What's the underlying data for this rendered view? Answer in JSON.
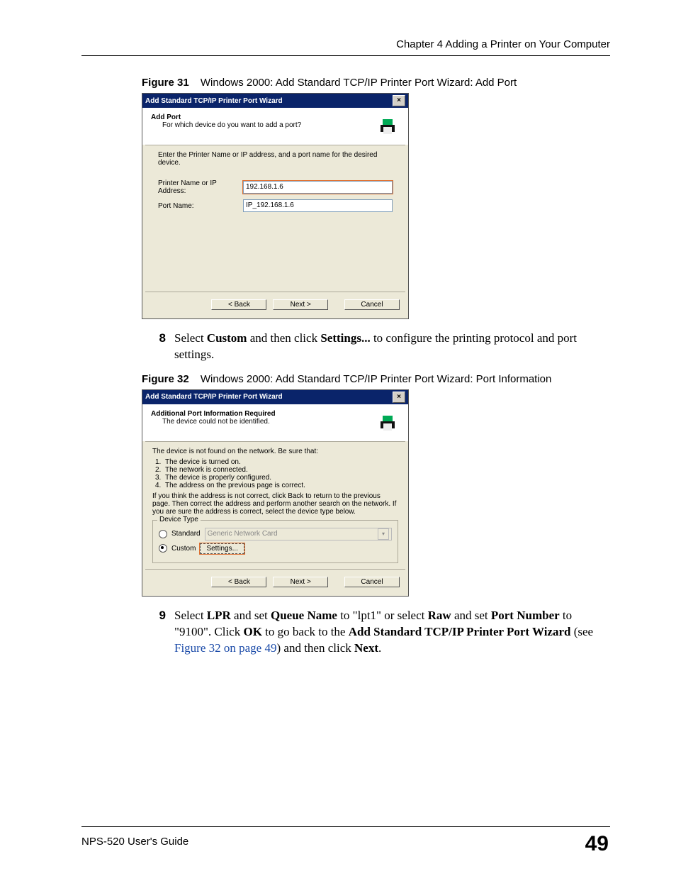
{
  "header": {
    "chapter": "Chapter 4 Adding a Printer on Your Computer"
  },
  "footer": {
    "guide": "NPS-520 User's Guide",
    "page": "49"
  },
  "fig31": {
    "label": "Figure 31",
    "caption": "Windows 2000: Add Standard TCP/IP Printer Port Wizard: Add Port",
    "dialog": {
      "title": "Add Standard TCP/IP Printer Port Wizard",
      "heading": "Add Port",
      "sub": "For which device do you want to add a port?",
      "intro": "Enter the Printer Name or IP address, and a port name for the desired device.",
      "field1_label": "Printer Name or IP Address:",
      "field1_value": "192.168.1.6",
      "field2_label": "Port Name:",
      "field2_value": "IP_192.168.1.6",
      "back": "< Back",
      "next": "Next >",
      "cancel": "Cancel"
    }
  },
  "step8": {
    "num": "8",
    "pre": "Select ",
    "b1": "Custom",
    "mid": " and then click ",
    "b2": "Settings...",
    "post": " to configure the printing protocol and port settings."
  },
  "fig32": {
    "label": "Figure 32",
    "caption": "Windows 2000: Add Standard TCP/IP Printer Port Wizard: Port Information",
    "dialog": {
      "title": "Add Standard TCP/IP Printer Port Wizard",
      "heading": "Additional Port Information Required",
      "sub": "The device could not be identified.",
      "intro": "The device is not found on the network.  Be sure that:",
      "list": [
        "The device is turned on.",
        "The network is connected.",
        "The device is properly configured.",
        "The address on the previous page is correct."
      ],
      "para": "If you think the address is not correct, click Back to return to the previous page. Then correct the address and perform another search on the network. If you are sure the address is correct, select the device type below.",
      "legend": "Device Type",
      "standard": "Standard",
      "combo": "Generic Network Card",
      "custom": "Custom",
      "settings": "Settings...",
      "back": "< Back",
      "next": "Next >",
      "cancel": "Cancel"
    }
  },
  "step9": {
    "num": "9",
    "t1": "Select ",
    "b1": "LPR",
    "t2": " and set ",
    "b2": "Queue Name",
    "t3": " to \"lpt1\" or select ",
    "b3": "Raw",
    "t4": " and set ",
    "b4": "Port Number",
    "t5": " to \"9100\". Click ",
    "b5": "OK",
    "t6": " to go back to the ",
    "b6": "Add Standard TCP/IP Printer Port Wizard",
    "t7": " (see ",
    "xref": "Figure 32 on page 49",
    "t8": ") and then click ",
    "b7": "Next",
    "t9": "."
  }
}
